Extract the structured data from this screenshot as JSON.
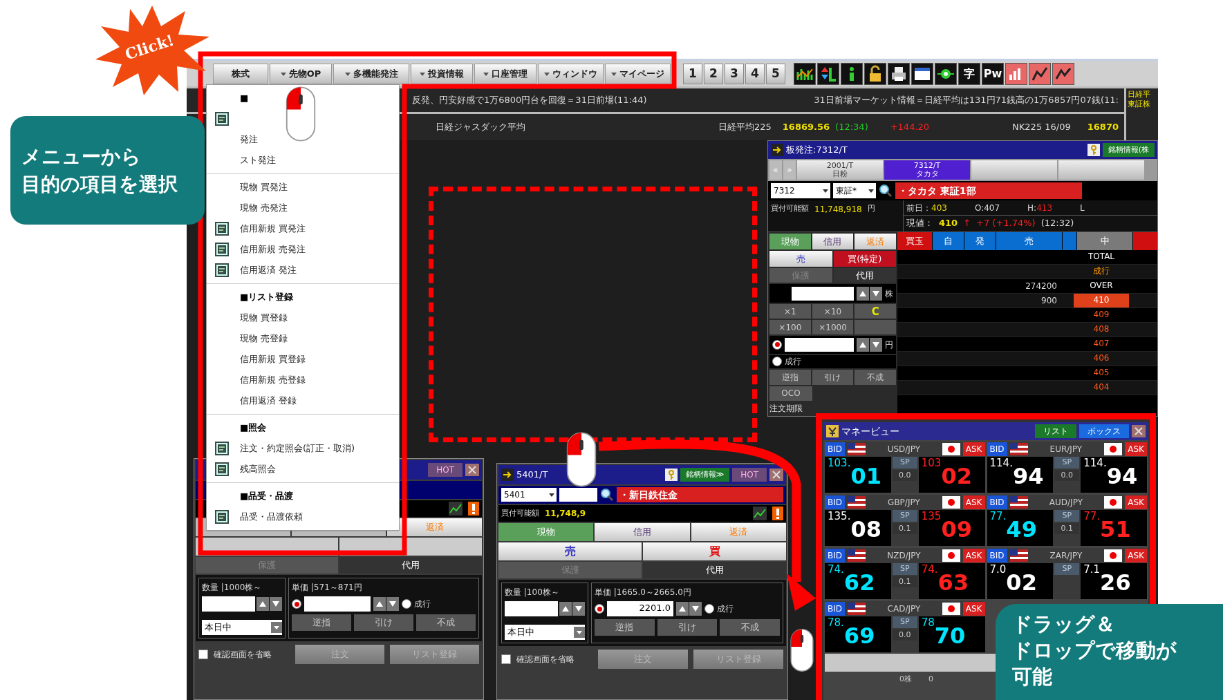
{
  "menu_bar": {
    "items": [
      "株式",
      "先物OP",
      "多機能発注",
      "投資情報",
      "口座管理",
      "ウィンドウ",
      "マイページ"
    ],
    "number_buttons": [
      "1",
      "2",
      "3",
      "4",
      "5"
    ],
    "text_buttons": [
      "字",
      "Pw"
    ]
  },
  "news_ticker": {
    "left": "反発、円安好感で1万6800円台を回復＝31日前場(11:44)",
    "right": "31日前場マーケット情報＝日経平均は131円71銭高の1万6857円07銭(11:",
    "side": [
      "日経平",
      "東証株"
    ]
  },
  "index_bar": {
    "jasdaq": "日経ジャスダック平均",
    "nikkei_label": "日経平均225",
    "nikkei_value": "16869.56",
    "nikkei_time": "(12:34)",
    "nikkei_change": "+144.20",
    "futures_label": "NK225 16/09",
    "futures_value": "16870"
  },
  "click_badge": "Click!",
  "menu_callout": [
    "メニューから",
    "目的の項目を選択"
  ],
  "drag_callout": [
    "ドラッグ＆",
    "ドロップで移動が",
    "可能"
  ],
  "dropdown_menu": {
    "sections": [
      {
        "heading": "■",
        "items": [
          {
            "icon": true
          },
          {
            "label": "発注",
            "icon": false
          },
          {
            "label": "スト発注",
            "icon": false
          }
        ]
      },
      {
        "items": [
          {
            "label": "現物 買発注",
            "icon": false
          },
          {
            "label": "現物 売発注",
            "icon": false
          },
          {
            "label": "信用新規 買発注",
            "icon": true
          },
          {
            "label": "信用新規 売発注",
            "icon": true
          },
          {
            "label": "信用返済 発注",
            "icon": true
          }
        ]
      },
      {
        "heading": "■リスト登録",
        "items": [
          {
            "label": "現物 買登録",
            "icon": false
          },
          {
            "label": "現物 売登録",
            "icon": false
          },
          {
            "label": "信用新規 買登録",
            "icon": false
          },
          {
            "label": "信用新規 売登録",
            "icon": false
          },
          {
            "label": "信用返済 登録",
            "icon": false
          }
        ]
      },
      {
        "heading": "■照会",
        "items": [
          {
            "label": "注文・約定照会(訂正・取消)",
            "icon": true
          },
          {
            "label": "残高照会",
            "icon": true
          }
        ]
      },
      {
        "heading": "■品受・品渡",
        "items": [
          {
            "label": "品受・品渡依頼",
            "icon": true
          }
        ]
      }
    ]
  },
  "order_board": {
    "title": "板発注:7312/T",
    "info_button": "銘柄情報(株",
    "nav": [
      "«",
      "»"
    ],
    "tabs": [
      {
        "code": "2001/T",
        "name": "日粉",
        "selected": false
      },
      {
        "code": "7312/T",
        "name": "タカタ",
        "selected": true
      },
      {
        "selected": false
      },
      {
        "selected": false
      }
    ],
    "code": "7312",
    "market": "東証*",
    "name": "・タカタ 東証1部",
    "buying_power_label": "買付可能額",
    "buying_power": "11,748,918",
    "yen": "円",
    "quote": [
      {
        "label": "前日：",
        "value": "403",
        "color": "#f0e000"
      },
      {
        "label": "O:",
        "value": "407",
        "color": "#e0e0e0"
      },
      {
        "label": "H:",
        "value": "413",
        "color": "#ff2020"
      },
      {
        "label": "L"
      }
    ],
    "current": {
      "label": "現値：",
      "value": "410",
      "arrow": "↑",
      "change": "+7 (+1.74%)",
      "time": "(12:32)"
    },
    "trade_tabs": [
      {
        "label": "現物",
        "selected": true
      },
      {
        "label": "信用",
        "selected": false,
        "color": "#503070"
      },
      {
        "label": "返済",
        "selected": false,
        "color": "#ff7a00"
      }
    ],
    "side": [
      {
        "label": "売",
        "selected": false
      },
      {
        "label": "買(特定)",
        "selected": true
      }
    ],
    "account": [
      {
        "label": "保護",
        "disabled": true
      },
      {
        "label": "代用",
        "disabled": false
      }
    ],
    "qty_unit": "株",
    "multipliers": [
      {
        "label": "×1"
      },
      {
        "label": "×10"
      },
      {
        "label": "C",
        "color": "#e8e800"
      },
      {
        "label": "×100"
      },
      {
        "label": "×1000"
      }
    ],
    "limit_selected": true,
    "price_unit": "円",
    "market_label": "成行",
    "order_types": [
      "逆指",
      "引け",
      "不成"
    ],
    "oco": "OCO",
    "deadline": "注文期限",
    "columns": [
      {
        "label": "買玉",
        "color": "#d01010"
      },
      {
        "label": "自",
        "color": "#0a6ed1"
      },
      {
        "label": "発",
        "color": "#0a6ed1"
      },
      {
        "label": "売",
        "color": "#0a6ed1"
      },
      {
        "color": "#0a6ed1"
      },
      {
        "label": "中",
        "color": "#7a7a7a"
      },
      {
        "color": "#d01010"
      }
    ],
    "rows": [
      {
        "price": "TOTAL",
        "kind": "total"
      },
      {
        "price": "成行",
        "kind": "market"
      },
      {
        "sell": "274200",
        "price": "OVER",
        "kind": "over"
      },
      {
        "sell": "900",
        "price": "410",
        "kind": "current"
      },
      {
        "price": "409",
        "kind": "price"
      },
      {
        "price": "408",
        "kind": "price"
      },
      {
        "price": "407",
        "kind": "price"
      },
      {
        "price": "406",
        "kind": "price"
      },
      {
        "price": "405",
        "kind": "price"
      },
      {
        "price": "404",
        "kind": "price"
      }
    ]
  },
  "order_windows": [
    {
      "hot": "HOT",
      "trade_tabs": [
        {
          "label": "返済",
          "selected": false,
          "color": "#ff7a00"
        }
      ],
      "account": [
        {
          "label": "保護",
          "disabled": true
        },
        {
          "label": "代用",
          "disabled": false
        }
      ],
      "qty_label": "数量 |1000株～",
      "price_label": "単価 |571～871円",
      "limit_selected": true,
      "market_label": "成行",
      "validity": "本日中",
      "order_types": [
        "逆指",
        "引け",
        "不成"
      ],
      "skip_confirm": {
        "label": "確認画面を省略",
        "checked": false
      },
      "buttons": [
        "注文",
        "リスト登録"
      ]
    },
    {
      "title": "5401/T",
      "info_button": "銘柄情報≫",
      "hot": "HOT",
      "code": "5401",
      "name": "・新日鉄住金",
      "buying_power_label": "買付可能額",
      "buying_power": "11,748,9",
      "trade_tabs": [
        {
          "label": "現物",
          "selected": true
        },
        {
          "label": "信用",
          "selected": false,
          "color": "#503070"
        },
        {
          "label": "返済",
          "selected": false,
          "color": "#ff7a00"
        }
      ],
      "side": [
        {
          "label": "売",
          "color": "#3030c0"
        },
        {
          "label": "買",
          "color": "#e01010"
        }
      ],
      "account": [
        {
          "label": "保護",
          "disabled": true
        },
        {
          "label": "代用",
          "disabled": false
        }
      ],
      "qty_label": "数量 |100株～",
      "price_label": "単価 |1665.0～2665.0円",
      "price_value": "2201.0",
      "limit_selected": true,
      "market_label": "成行",
      "validity": "本日中",
      "order_types": [
        "逆指",
        "引け",
        "不成"
      ],
      "skip_confirm": {
        "label": "確認画面を省略",
        "checked": false
      },
      "buttons": [
        "注文",
        "リスト登録"
      ]
    }
  ],
  "money_view": {
    "title": "マネービュー",
    "buttons": [
      {
        "label": "リスト",
        "selected": false
      },
      {
        "label": "ボックス",
        "selected": true
      }
    ],
    "pairs": [
      {
        "pair": "USD/JPY",
        "bid_label": "BID",
        "ask_label": "ASK",
        "bid": {
          "head": "103.",
          "tail": "01",
          "color": "#00e5ff"
        },
        "spread_label": "SP",
        "spread": "0.0",
        "ask": {
          "head": "103",
          "tail": "02",
          "color": "#ff2020"
        }
      },
      {
        "pair": "EUR/JPY",
        "bid_label": "BID",
        "ask_label": "ASK",
        "bid": {
          "head": "114.",
          "tail": "94",
          "color": "#ffffff"
        },
        "spread_label": "SP",
        "spread": "0.0",
        "ask": {
          "head": "114.",
          "tail": "94",
          "color": "#ffffff"
        }
      },
      {
        "pair": "GBP/JPY",
        "bid_label": "BID",
        "ask_label": "ASK",
        "bid": {
          "head": "135.",
          "tail": "08",
          "color": "#ffffff"
        },
        "spread_label": "SP",
        "spread": "0.1",
        "ask": {
          "head": "135",
          "tail": "09",
          "color": "#ff2020"
        }
      },
      {
        "pair": "AUD/JPY",
        "bid_label": "BID",
        "ask_label": "ASK",
        "bid": {
          "head": "77.",
          "tail": "49",
          "color": "#00e5ff"
        },
        "spread_label": "SP",
        "spread": "0.1",
        "ask": {
          "head": "77.",
          "tail": "51",
          "color": "#ff2020"
        }
      },
      {
        "pair": "NZD/JPY",
        "bid_label": "BID",
        "ask_label": "ASK",
        "bid": {
          "head": "74.",
          "tail": "62",
          "color": "#00e5ff"
        },
        "spread_label": "SP",
        "spread": "0.1",
        "ask": {
          "head": "74.",
          "tail": "63",
          "color": "#ff2020"
        }
      },
      {
        "pair": "ZAR/JPY",
        "bid_label": "BID",
        "ask_label": "ASK",
        "bid": {
          "head": "7.0",
          "tail": "02",
          "color": "#ffffff"
        },
        "spread_label": "SP",
        "ask": {
          "head": "7.1",
          "tail": "26",
          "color": "#ffffff"
        }
      },
      {
        "pair": "CAD/JPY",
        "bid_label": "BID",
        "ask_label": "ASK",
        "bid": {
          "head": "78.",
          "tail": "69",
          "color": "#00e5ff"
        },
        "spread_label": "SP",
        "spread": "0.0",
        "ask": {
          "head": "78",
          "tail": "70",
          "color": "#00e5ff"
        }
      }
    ],
    "status": [
      "0株",
      "0"
    ]
  }
}
